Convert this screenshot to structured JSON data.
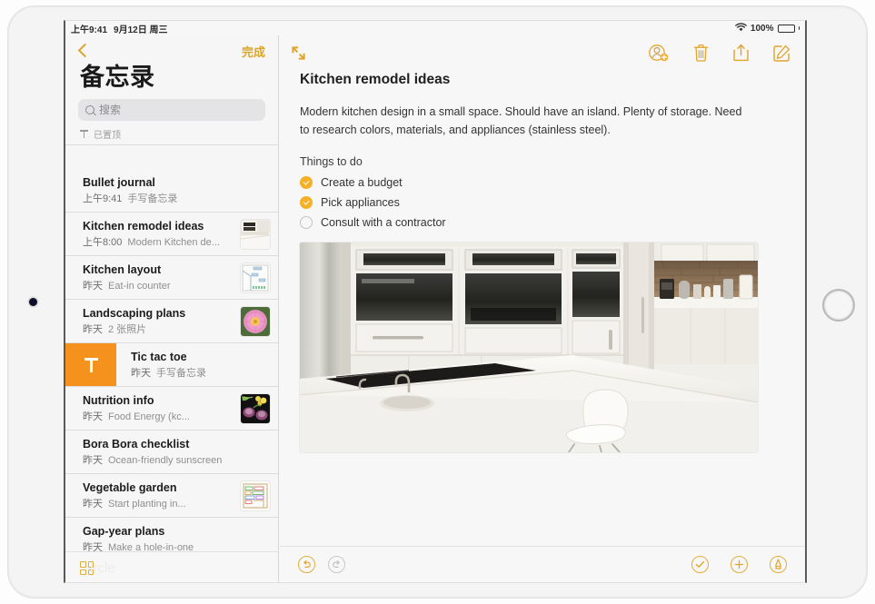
{
  "statusbar": {
    "time": "上午9:41",
    "date": "9月12日 周三",
    "wifi_icon": "wifi-icon",
    "battery_percent": "100%",
    "battery_icon": "battery-full-icon"
  },
  "sidebar": {
    "back_icon": "chevron-left-icon",
    "done_label": "完成",
    "title": "备忘录",
    "search": {
      "placeholder": "搜索",
      "icon": "search-icon",
      "value": ""
    },
    "pinned_section": {
      "label": "已置顶",
      "icon": "pin-icon"
    },
    "notes": [
      {
        "title": "Bullet journal",
        "date": "上午9:41",
        "preview": "手写备忘录",
        "thumb": "none",
        "pinned": true,
        "selected": false
      },
      {
        "title": "Kitchen remodel ideas",
        "date": "上午8:00",
        "preview": "Modern Kitchen de...",
        "thumb": "kitchen",
        "pinned": false,
        "selected": false
      },
      {
        "title": "Kitchen layout",
        "date": "昨天",
        "preview": "Eat-in counter",
        "thumb": "floorplan",
        "pinned": false,
        "selected": false
      },
      {
        "title": "Landscaping plans",
        "date": "昨天",
        "preview": "2 张照片",
        "thumb": "flower",
        "pinned": false,
        "selected": false
      },
      {
        "title": "Tic tac toe",
        "date": "昨天",
        "preview": "手写备忘录",
        "thumb": "none",
        "pinned": true,
        "selected": false,
        "swipe_action": "pin"
      },
      {
        "title": "Nutrition info",
        "date": "昨天",
        "preview": "Food Energy (kc...",
        "thumb": "veggies",
        "pinned": false,
        "selected": false
      },
      {
        "title": "Bora Bora checklist",
        "date": "昨天",
        "preview": "Ocean-friendly sunscreen",
        "thumb": "none",
        "pinned": false,
        "selected": false
      },
      {
        "title": "Vegetable garden",
        "date": "昨天",
        "preview": "Start planting in...",
        "thumb": "garden",
        "pinned": false,
        "selected": false
      },
      {
        "title": "Gap-year plans",
        "date": "昨天",
        "preview": "Make a hole-in-one",
        "thumb": "none",
        "pinned": false,
        "selected": false
      }
    ],
    "bottom": {
      "folders_icon": "grid-folders-icon",
      "ghost_label": "ircle"
    }
  },
  "detail": {
    "expand_icon": "expand-arrows-icon",
    "toolbar": [
      {
        "name": "add-person-icon",
        "label": ""
      },
      {
        "name": "trash-icon",
        "label": ""
      },
      {
        "name": "share-icon",
        "label": ""
      },
      {
        "name": "compose-icon",
        "label": ""
      }
    ],
    "note": {
      "heading": "Kitchen remodel ideas",
      "paragraph": "Modern kitchen design in a small space. Should have an island. Plenty of storage. Need to research colors, materials, and appliances (stainless steel).",
      "todo_label": "Things to do",
      "todos": [
        {
          "text": "Create a budget",
          "checked": true
        },
        {
          "text": "Pick appliances",
          "checked": true
        },
        {
          "text": "Consult with a contractor",
          "checked": false
        }
      ],
      "photo_alt": "Modern white kitchen with island and stainless appliances"
    },
    "bottom_toolbar": {
      "undo": {
        "icon": "undo-icon",
        "enabled": true
      },
      "redo": {
        "icon": "redo-icon",
        "enabled": false
      },
      "checklist": {
        "icon": "checklist-icon",
        "enabled": true
      },
      "add": {
        "icon": "plus-icon",
        "enabled": true
      },
      "markup": {
        "icon": "markup-pen-icon",
        "enabled": true
      }
    }
  },
  "colors": {
    "accent": "#d9a62c",
    "checkbox_filled": "#f5b026",
    "pin_action": "#f5921e",
    "screen_bg": "#f7f7f7"
  }
}
